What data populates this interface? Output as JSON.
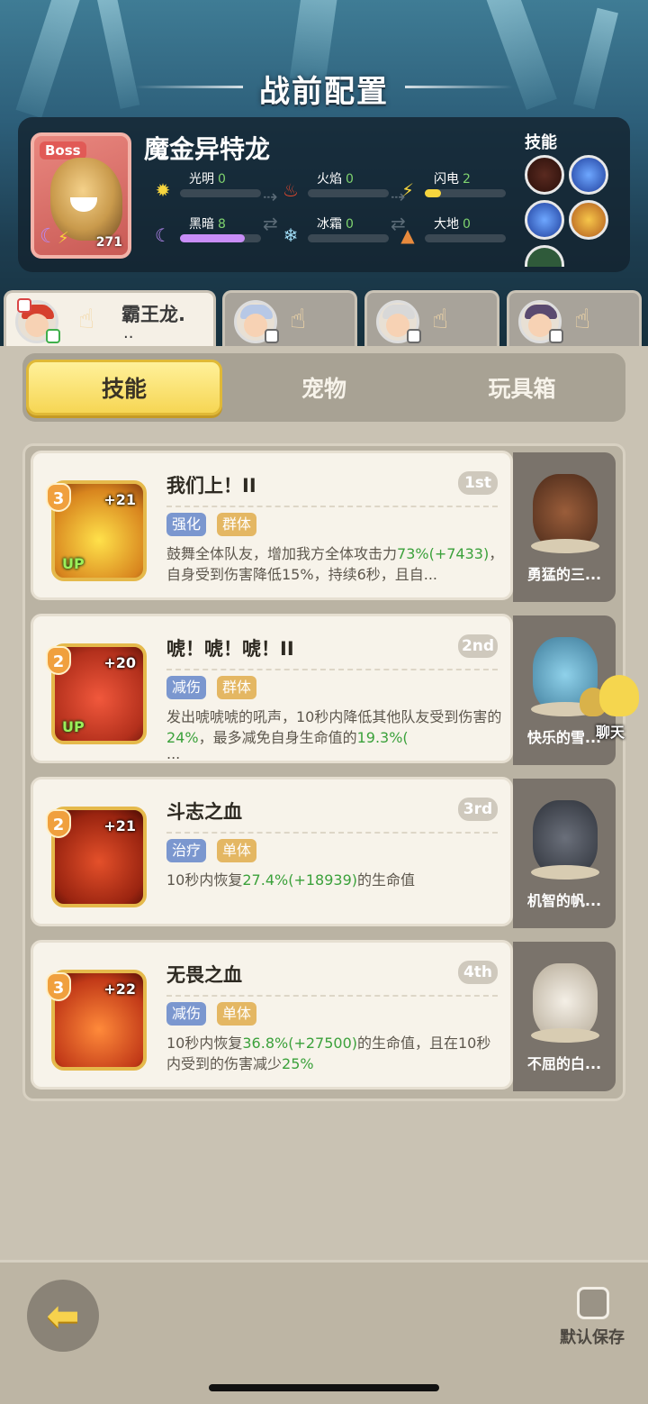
{
  "title": "战前配置",
  "boss": {
    "tag": "Boss",
    "name": "魔金异特龙",
    "level": "271",
    "elements": [
      {
        "name": "光明",
        "value": "0",
        "icon": "sun-icon",
        "fill": 0
      },
      {
        "name": "火焰",
        "value": "0",
        "icon": "flame-icon",
        "fill": 0
      },
      {
        "name": "闪电",
        "value": "2",
        "icon": "lightning-icon",
        "fill": 0.2
      },
      {
        "name": "黑暗",
        "value": "8",
        "icon": "moon-icon",
        "fill": 0.8
      },
      {
        "name": "冰霜",
        "value": "0",
        "icon": "snowflake-icon",
        "fill": 0
      },
      {
        "name": "大地",
        "value": "0",
        "icon": "mountain-icon",
        "fill": 0
      }
    ],
    "skills_label": "技能"
  },
  "characters": [
    {
      "name": "霸王龙.",
      "dots": "..",
      "active": true
    },
    {
      "name": "",
      "active": false
    },
    {
      "name": "",
      "active": false
    },
    {
      "name": "",
      "active": false
    }
  ],
  "tabs": [
    "技能",
    "宠物",
    "玩具箱"
  ],
  "skills": [
    {
      "level": "3",
      "plus": "+21",
      "up": "UP",
      "title": "我们上！II",
      "rank": "1st",
      "tags": [
        "强化",
        "群体"
      ],
      "desc": [
        {
          "t": "鼓舞全体队友，增加我方全体攻击力",
          "g": false
        },
        {
          "t": "73%(+7433)",
          "g": true
        },
        {
          "t": "，自身受到伤害降低15%，持续6秒，且自...",
          "g": false
        }
      ]
    },
    {
      "level": "2",
      "plus": "+20",
      "up": "UP",
      "title": "唬！唬！唬！II",
      "rank": "2nd",
      "tags": [
        "减伤",
        "群体"
      ],
      "desc": [
        {
          "t": "发出唬唬唬的吼声，10秒内降低其他队友受到伤害的",
          "g": false
        },
        {
          "t": "24%",
          "g": true
        },
        {
          "t": "，最多减免自身生命值的",
          "g": false
        },
        {
          "t": "19.3%(",
          "g": true
        },
        {
          "t": "...",
          "g": false
        }
      ]
    },
    {
      "level": "2",
      "plus": "+21",
      "up": "",
      "title": "斗志之血",
      "rank": "3rd",
      "tags": [
        "治疗",
        "单体"
      ],
      "desc": [
        {
          "t": "10秒内恢复",
          "g": false
        },
        {
          "t": "27.4%(+18939)",
          "g": true
        },
        {
          "t": "的生命值",
          "g": false
        }
      ]
    },
    {
      "level": "3",
      "plus": "+22",
      "up": "",
      "title": "无畏之血",
      "rank": "4th",
      "tags": [
        "减伤",
        "单体"
      ],
      "desc": [
        {
          "t": "10秒内恢复",
          "g": false
        },
        {
          "t": "36.8%(+27500)",
          "g": true
        },
        {
          "t": "的生命值，且在10秒内受到的伤害减少",
          "g": false
        },
        {
          "t": "25%",
          "g": true
        }
      ]
    }
  ],
  "pets": [
    "勇猛的三...",
    "快乐的雪...",
    "机智的帆...",
    "不屈的白..."
  ],
  "chat_label": "聊天",
  "save_label": "默认保存",
  "colors": {
    "accent": "#f6d654",
    "green": "#3ba13b",
    "panel": "#f7f3ea"
  }
}
